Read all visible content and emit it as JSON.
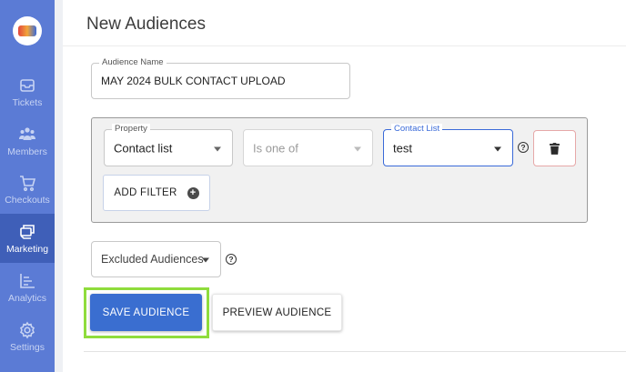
{
  "sidebar": {
    "logo_name": "company-logo",
    "items": [
      {
        "label": "Tickets",
        "icon": "tickets-icon",
        "active": false
      },
      {
        "label": "Members",
        "icon": "members-icon",
        "active": false
      },
      {
        "label": "Checkouts",
        "icon": "cart-icon",
        "active": false
      },
      {
        "label": "Marketing",
        "icon": "marketing-icon",
        "active": true
      },
      {
        "label": "Analytics",
        "icon": "analytics-icon",
        "active": false
      },
      {
        "label": "Settings",
        "icon": "settings-icon",
        "active": false
      }
    ]
  },
  "page": {
    "title": "New Audiences"
  },
  "form": {
    "audience_name": {
      "label": "Audience Name",
      "value": "MAY 2024 BULK CONTACT UPLOAD"
    },
    "filter": {
      "property": {
        "label": "Property",
        "value": "Contact list"
      },
      "operator": {
        "value": "Is one of"
      },
      "contact_list": {
        "label": "Contact List",
        "value": "test"
      },
      "help_symbol": "?",
      "add_filter_label": "ADD FILTER",
      "add_symbol": "+"
    },
    "excluded": {
      "value": "Excluded Audiences",
      "help_symbol": "?"
    }
  },
  "actions": {
    "save_label": "SAVE AUDIENCE",
    "preview_label": "PREVIEW AUDIENCE"
  },
  "colors": {
    "sidebar": "#5b7bd5",
    "sidebar_active": "#3f5fb8",
    "primary_button": "#3a6ed0",
    "focus_field": "#3a6ad8",
    "highlight": "#8fdc3c",
    "delete_border": "#e6a8a8"
  }
}
